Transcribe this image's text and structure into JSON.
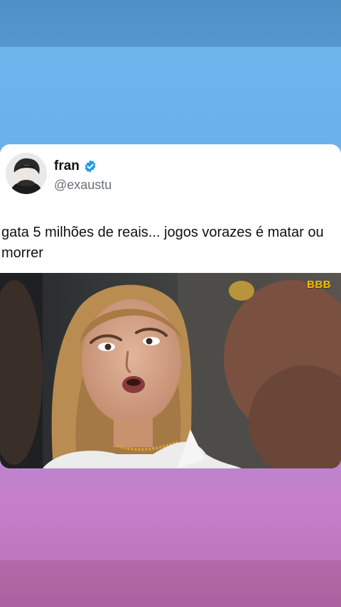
{
  "post": {
    "author": {
      "name": "fran",
      "handle": "@exaustu",
      "verified": true
    },
    "text": "gata 5 milhões de reais... jogos vorazes é matar ou morrer",
    "media": {
      "watermark": "BBB"
    }
  },
  "colors": {
    "background_top": "#6ab2ec",
    "background_bottom": "#c77fca",
    "verified_badge": "#1d9bf0",
    "watermark": "#f0c000"
  },
  "icons": {
    "verified": "verified-badge-icon",
    "avatar": "user-avatar"
  }
}
